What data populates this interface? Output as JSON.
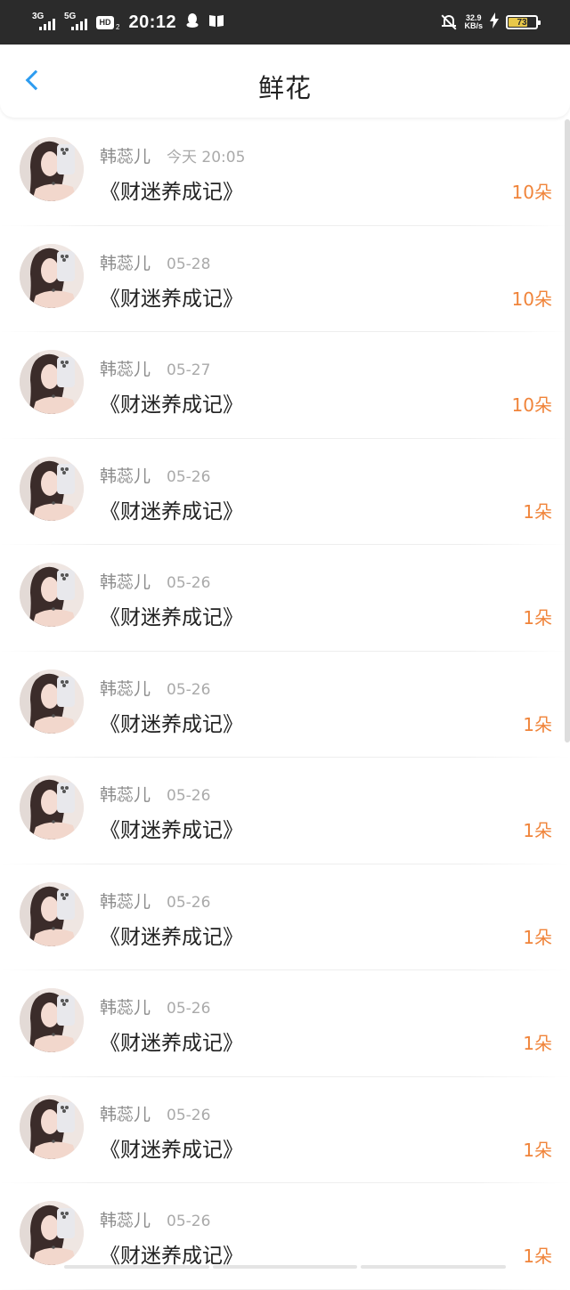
{
  "status_bar": {
    "network_1": "3G",
    "network_2": "5G",
    "hd_label": "HD",
    "hd_sub": "2",
    "time": "20:12",
    "speed_value": "32.9",
    "speed_unit": "KB/s",
    "battery_level": "73",
    "battery_percent": 73,
    "icons": [
      "signal-icon",
      "signal-icon",
      "hd-icon",
      "qq-icon",
      "book-icon",
      "bell-off-icon",
      "charging-icon",
      "battery-icon"
    ]
  },
  "header": {
    "title": "鲜花",
    "back_icon": "chevron-left-icon"
  },
  "colors": {
    "accent_blue": "#2d9cf0",
    "count_orange": "#f0843a",
    "status_bar_bg": "#2b2b2b",
    "battery_fill": "#e8c84a"
  },
  "records": [
    {
      "name": "韩蕊儿",
      "date": "今天 20:05",
      "title": "《财迷养成记》",
      "count": "10朵"
    },
    {
      "name": "韩蕊儿",
      "date": "05-28",
      "title": "《财迷养成记》",
      "count": "10朵"
    },
    {
      "name": "韩蕊儿",
      "date": "05-27",
      "title": "《财迷养成记》",
      "count": "10朵"
    },
    {
      "name": "韩蕊儿",
      "date": "05-26",
      "title": "《财迷养成记》",
      "count": "1朵"
    },
    {
      "name": "韩蕊儿",
      "date": "05-26",
      "title": "《财迷养成记》",
      "count": "1朵"
    },
    {
      "name": "韩蕊儿",
      "date": "05-26",
      "title": "《财迷养成记》",
      "count": "1朵"
    },
    {
      "name": "韩蕊儿",
      "date": "05-26",
      "title": "《财迷养成记》",
      "count": "1朵"
    },
    {
      "name": "韩蕊儿",
      "date": "05-26",
      "title": "《财迷养成记》",
      "count": "1朵"
    },
    {
      "name": "韩蕊儿",
      "date": "05-26",
      "title": "《财迷养成记》",
      "count": "1朵"
    },
    {
      "name": "韩蕊儿",
      "date": "05-26",
      "title": "《财迷养成记》",
      "count": "1朵"
    },
    {
      "name": "韩蕊儿",
      "date": "05-26",
      "title": "《财迷养成记》",
      "count": "1朵"
    }
  ]
}
